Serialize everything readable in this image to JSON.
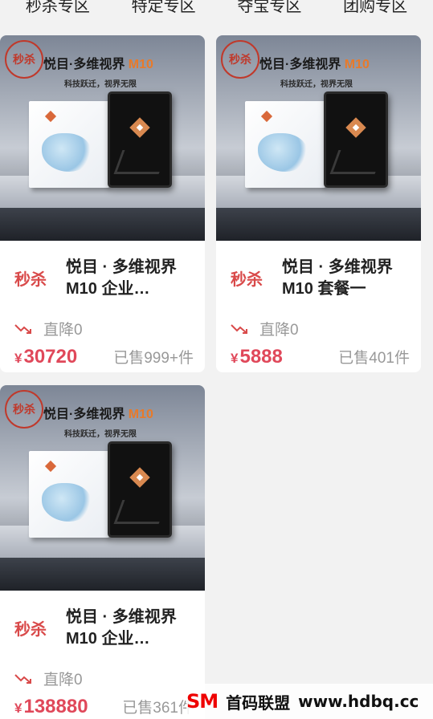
{
  "tabs": [
    "秒杀专区",
    "特定专区",
    "夺宝专区",
    "团购专区"
  ],
  "banner": {
    "badge": "秒杀",
    "brand_prefix": "悦目·多维视界 ",
    "brand_accent": "M10",
    "slogan": "科技跃迁，视界无限"
  },
  "products": [
    {
      "tag": "秒杀",
      "title": "悦目 · 多维视界M10 企业…",
      "drop": "直降0",
      "currency": "¥",
      "price": "30720",
      "sold": "已售999+件"
    },
    {
      "tag": "秒杀",
      "title": "悦目 · 多维视界M10 套餐一",
      "drop": "直降0",
      "currency": "¥",
      "price": "5888",
      "sold": "已售401件"
    },
    {
      "tag": "秒杀",
      "title": "悦目 · 多维视界M10 企业…",
      "drop": "直降0",
      "currency": "¥",
      "price": "138880",
      "sold": "已售361件"
    }
  ],
  "watermark": {
    "logo": "SM",
    "name": "首码联盟",
    "url": "www.hdbq.cc"
  },
  "colors": {
    "tag": "#d94a4a",
    "price": "#e0485a",
    "accent": "#e87a2a"
  }
}
